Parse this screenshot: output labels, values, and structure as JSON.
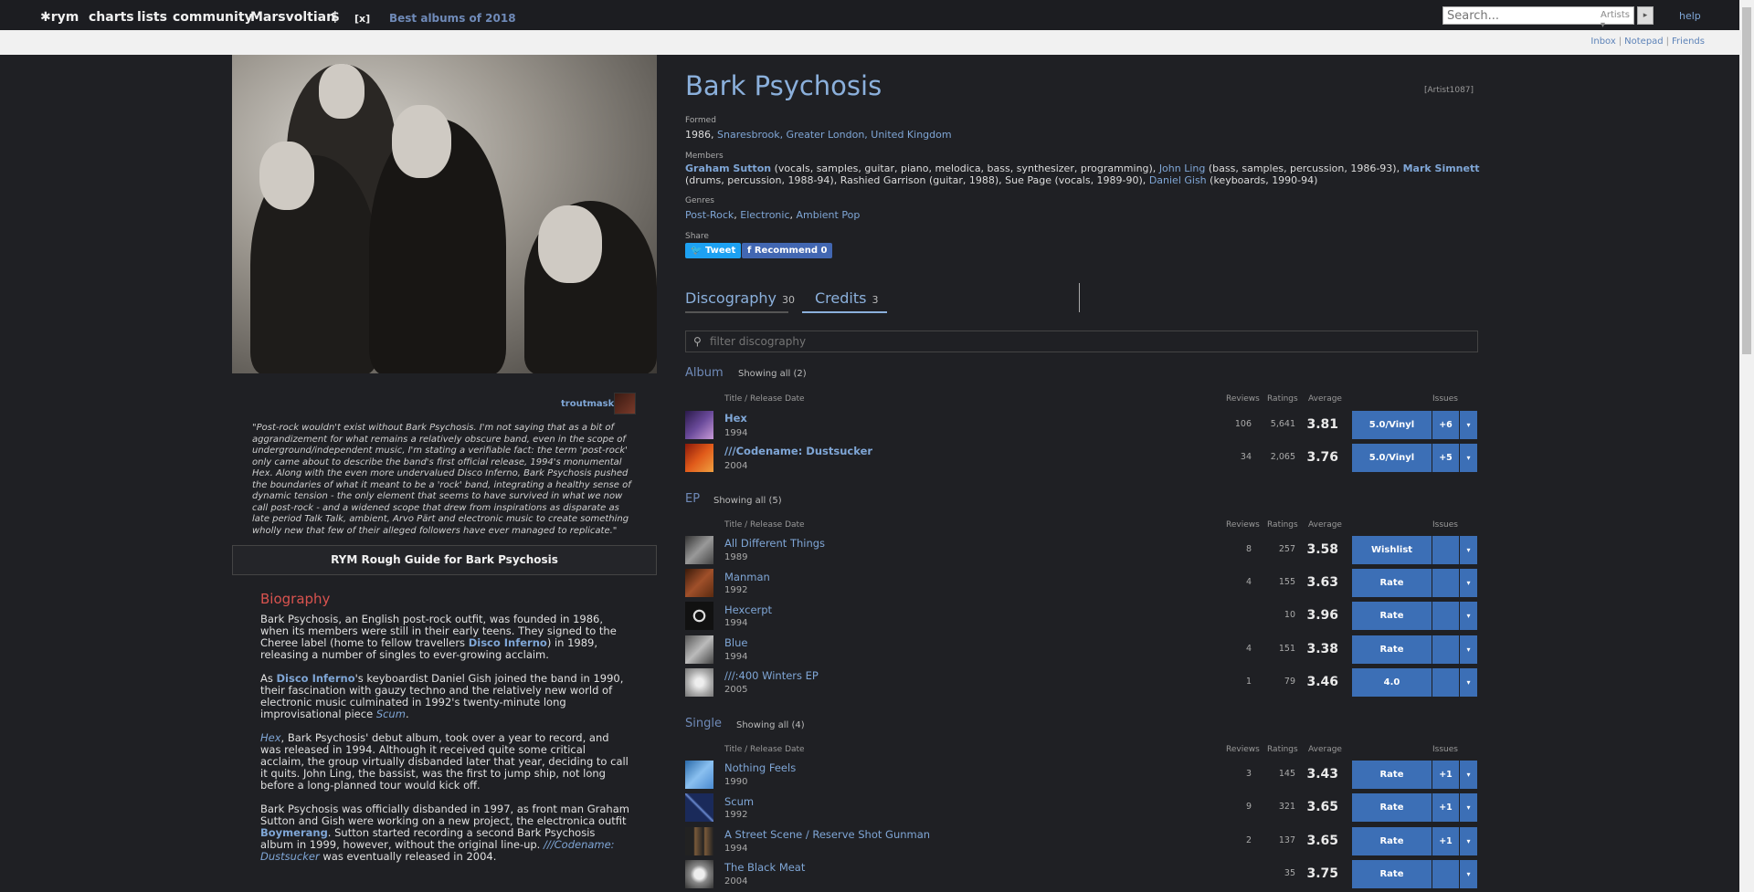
{
  "nav": {
    "logo": "✱rym",
    "charts": "charts",
    "lists": "lists",
    "community": "community",
    "user": "Marsvoltian",
    "dollar": "$",
    "close": "[x]",
    "best": "Best albums of 2018",
    "search_placeholder": "Search...",
    "search_type": "Artists ▾",
    "search_go": "▸",
    "help": "help"
  },
  "subbar": {
    "inbox": "Inbox",
    "notepad": "Notepad",
    "friends": "Friends",
    "sep": "|"
  },
  "left": {
    "uploader": "troutmask",
    "quote": "\"Post-rock wouldn't exist without Bark Psychosis. I'm not saying that as a bit of aggrandizement for what remains a relatively obscure band, even in the scope of underground/independent music, I'm stating a verifiable fact: the term 'post-rock' only came about to describe the band's first official release, 1994's monumental Hex. Along with the even more undervalued Disco Inferno, Bark Psychosis pushed the boundaries of what it meant to be a 'rock' band, integrating a healthy sense of dynamic tension - the only element that seems to have survived in what we now call post-rock - and a widened scope that drew from inspirations as disparate as late period Talk Talk, ambient, Arvo Pärt and electronic music to create something wholly new that few of their alleged followers have ever managed to replicate.\"",
    "guide": "RYM Rough Guide for Bark Psychosis",
    "bio_title": "Biography",
    "bio1_a": "Bark Psychosis, an English post-rock outfit, was founded in 1986, when its members were still in their early teens. They signed to the Cheree label (home to fellow travellers ",
    "bio1_link": "Disco Inferno",
    "bio1_b": ") in 1989, releasing a number of singles to ever-growing acclaim.",
    "bio2_a": "As ",
    "bio2_link": "Disco Inferno",
    "bio2_b": "'s keyboardist Daniel Gish joined the band in 1990, their fascination with gauzy techno and the relatively new world of electronic music culminated in 1992's twenty-minute long improvisational piece ",
    "bio2_it": "Scum",
    "bio2_c": ".",
    "bio3_it": "Hex",
    "bio3_b": ", Bark Psychosis' debut album, took over a year to record, and was released in 1994. Although it received quite some critical acclaim, the group virtually disbanded later that year, deciding to call it quits. John Ling, the bassist, was the first to jump ship, not long before a long-planned tour would kick off.",
    "bio4_a": "Bark Psychosis was officially disbanded in 1997, as front man Graham Sutton and Gish were working on a new project, the electronica outfit ",
    "bio4_link": "Boymerang",
    "bio4_b": ". Sutton started recording a second Bark Psychosis album in 1999, however, without the original line-up. ",
    "bio4_it": "///Codename: Dustsucker",
    "bio4_c": " was eventually released in 2004."
  },
  "artist": {
    "name": "Bark Psychosis",
    "id": "[Artist1087]",
    "formed_label": "Formed",
    "formed_year": "1986, ",
    "formed_place": "Snaresbrook, Greater London, United Kingdom",
    "members_label": "Members",
    "m1": "Graham Sutton",
    "m1_role": " (vocals, samples, guitar, piano, melodica, bass, synthesizer, programming), ",
    "m2": "John Ling",
    "m2_role": " (bass, samples, percussion, 1986-93), ",
    "m3": "Mark Simnett",
    "m3_role": " (drums, percussion, 1988-94), Rashied Garrison (guitar, 1988), Sue Page (vocals, 1989-90), ",
    "m4": "Daniel Gish",
    "m4_role": " (keyboards, 1990-94)",
    "genres_label": "Genres",
    "g1": "Post-Rock",
    "g2": "Electronic",
    "g3": "Ambient Pop",
    "comma": ", ",
    "share_label": "Share",
    "tweet": "Tweet",
    "recommend": "Recommend 0"
  },
  "tabs": {
    "disc": "Discography",
    "disc_count": "30",
    "credits": "Credits",
    "credits_count": "3"
  },
  "filter_placeholder": "filter discography",
  "headers": {
    "title": "Title / Release Date",
    "reviews": "Reviews",
    "ratings": "Ratings",
    "average": "Average",
    "issues": "Issues"
  },
  "sections": {
    "album": {
      "title": "Album",
      "showing": "Showing all (2)"
    },
    "ep": {
      "title": "EP",
      "showing": "Showing all (5)"
    },
    "single": {
      "title": "Single",
      "showing": "Showing all (4)"
    }
  },
  "albums": [
    {
      "title": "Hex",
      "date": "1994",
      "reviews": "106",
      "ratings": "5,641",
      "avg": "3.81",
      "btn": "5.0/Vinyl",
      "issues": "+6",
      "drop": "▾"
    },
    {
      "title": "///Codename: Dustsucker",
      "date": "2004",
      "reviews": "34",
      "ratings": "2,065",
      "avg": "3.76",
      "btn": "5.0/Vinyl",
      "issues": "+5",
      "drop": "▾"
    }
  ],
  "eps": [
    {
      "title": "All Different Things",
      "date": "1989",
      "reviews": "8",
      "ratings": "257",
      "avg": "3.58",
      "btn": "Wishlist",
      "issues": "",
      "drop": "▾"
    },
    {
      "title": "Manman",
      "date": "1992",
      "reviews": "4",
      "ratings": "155",
      "avg": "3.63",
      "btn": "Rate",
      "issues": "",
      "drop": "▾"
    },
    {
      "title": "Hexcerpt",
      "date": "1994",
      "reviews": "",
      "ratings": "10",
      "avg": "3.96",
      "btn": "Rate",
      "issues": "",
      "drop": "▾"
    },
    {
      "title": "Blue",
      "date": "1994",
      "reviews": "4",
      "ratings": "151",
      "avg": "3.38",
      "btn": "Rate",
      "issues": "",
      "drop": "▾"
    },
    {
      "title": "///:400 Winters EP",
      "date": "2005",
      "reviews": "1",
      "ratings": "79",
      "avg": "3.46",
      "btn": "4.0",
      "issues": "",
      "drop": "▾"
    }
  ],
  "singles": [
    {
      "title": "Nothing Feels",
      "date": "1990",
      "reviews": "3",
      "ratings": "145",
      "avg": "3.43",
      "btn": "Rate",
      "issues": "+1",
      "drop": "▾"
    },
    {
      "title": "Scum",
      "date": "1992",
      "reviews": "9",
      "ratings": "321",
      "avg": "3.65",
      "btn": "Rate",
      "issues": "+1",
      "drop": "▾"
    },
    {
      "title": "A Street Scene / Reserve Shot Gunman",
      "date": "1994",
      "reviews": "2",
      "ratings": "137",
      "avg": "3.65",
      "btn": "Rate",
      "issues": "+1",
      "drop": "▾"
    },
    {
      "title": "The Black Meat",
      "date": "2004",
      "reviews": "",
      "ratings": "35",
      "avg": "3.75",
      "btn": "Rate",
      "issues": "",
      "drop": "▾"
    }
  ],
  "colors": {
    "accent": "#3c6fb6",
    "link": "#7fa6d6",
    "background": "#1f2024",
    "bio_title": "#d9534f"
  }
}
